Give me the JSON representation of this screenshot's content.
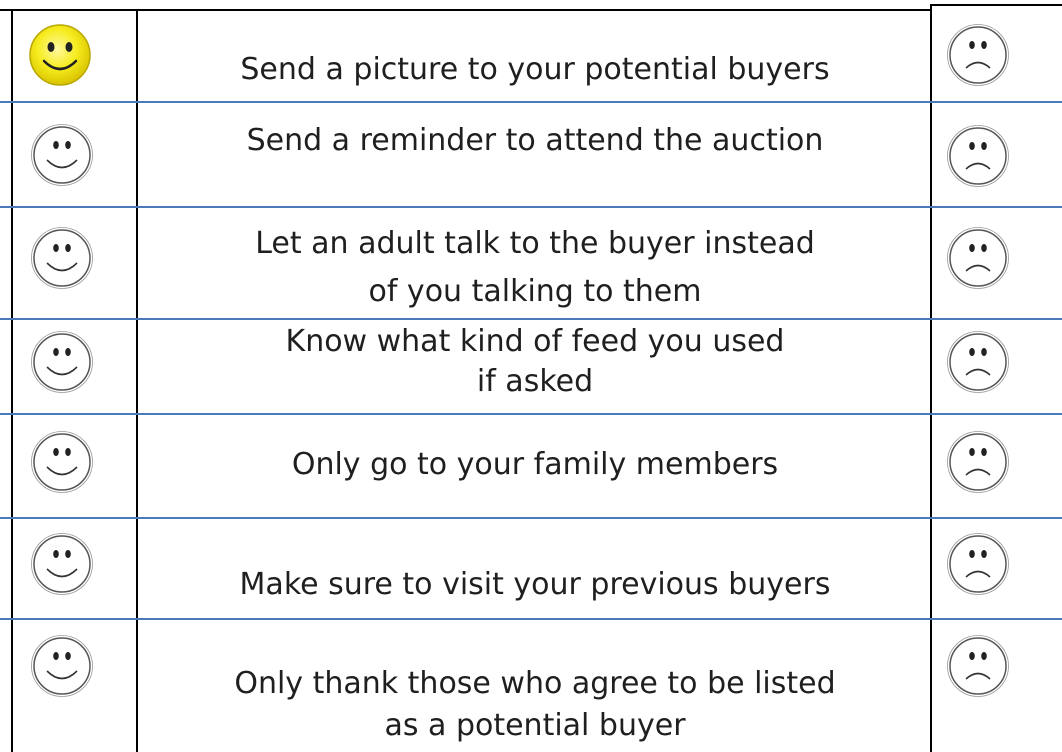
{
  "colors": {
    "happy_fill": "#f6ec1e",
    "face_outline": "#555555",
    "row_divider": "#4a7ab8",
    "frame": "#000000"
  },
  "rows": [
    {
      "lines": [
        "Send a picture to your potential buyers"
      ],
      "agree_icon": "smiley-face-highlighted",
      "disagree_icon": "frowny-face"
    },
    {
      "lines": [
        "Send a reminder to attend the auction"
      ],
      "agree_icon": "smiley-face",
      "disagree_icon": "frowny-face"
    },
    {
      "lines": [
        "Let an adult talk to the buyer instead",
        "of you talking to them"
      ],
      "agree_icon": "smiley-face",
      "disagree_icon": "frowny-face"
    },
    {
      "lines": [
        "Know what kind of feed you used",
        "if asked"
      ],
      "agree_icon": "smiley-face",
      "disagree_icon": "frowny-face"
    },
    {
      "lines": [
        "Only go to your family members"
      ],
      "agree_icon": "smiley-face",
      "disagree_icon": "frowny-face"
    },
    {
      "lines": [
        "Make sure to visit your previous buyers"
      ],
      "agree_icon": "smiley-face",
      "disagree_icon": "frowny-face"
    },
    {
      "lines": [
        "Only thank those who agree to be listed",
        "as a potential buyer"
      ],
      "agree_icon": "smiley-face",
      "disagree_icon": "frowny-face"
    }
  ]
}
